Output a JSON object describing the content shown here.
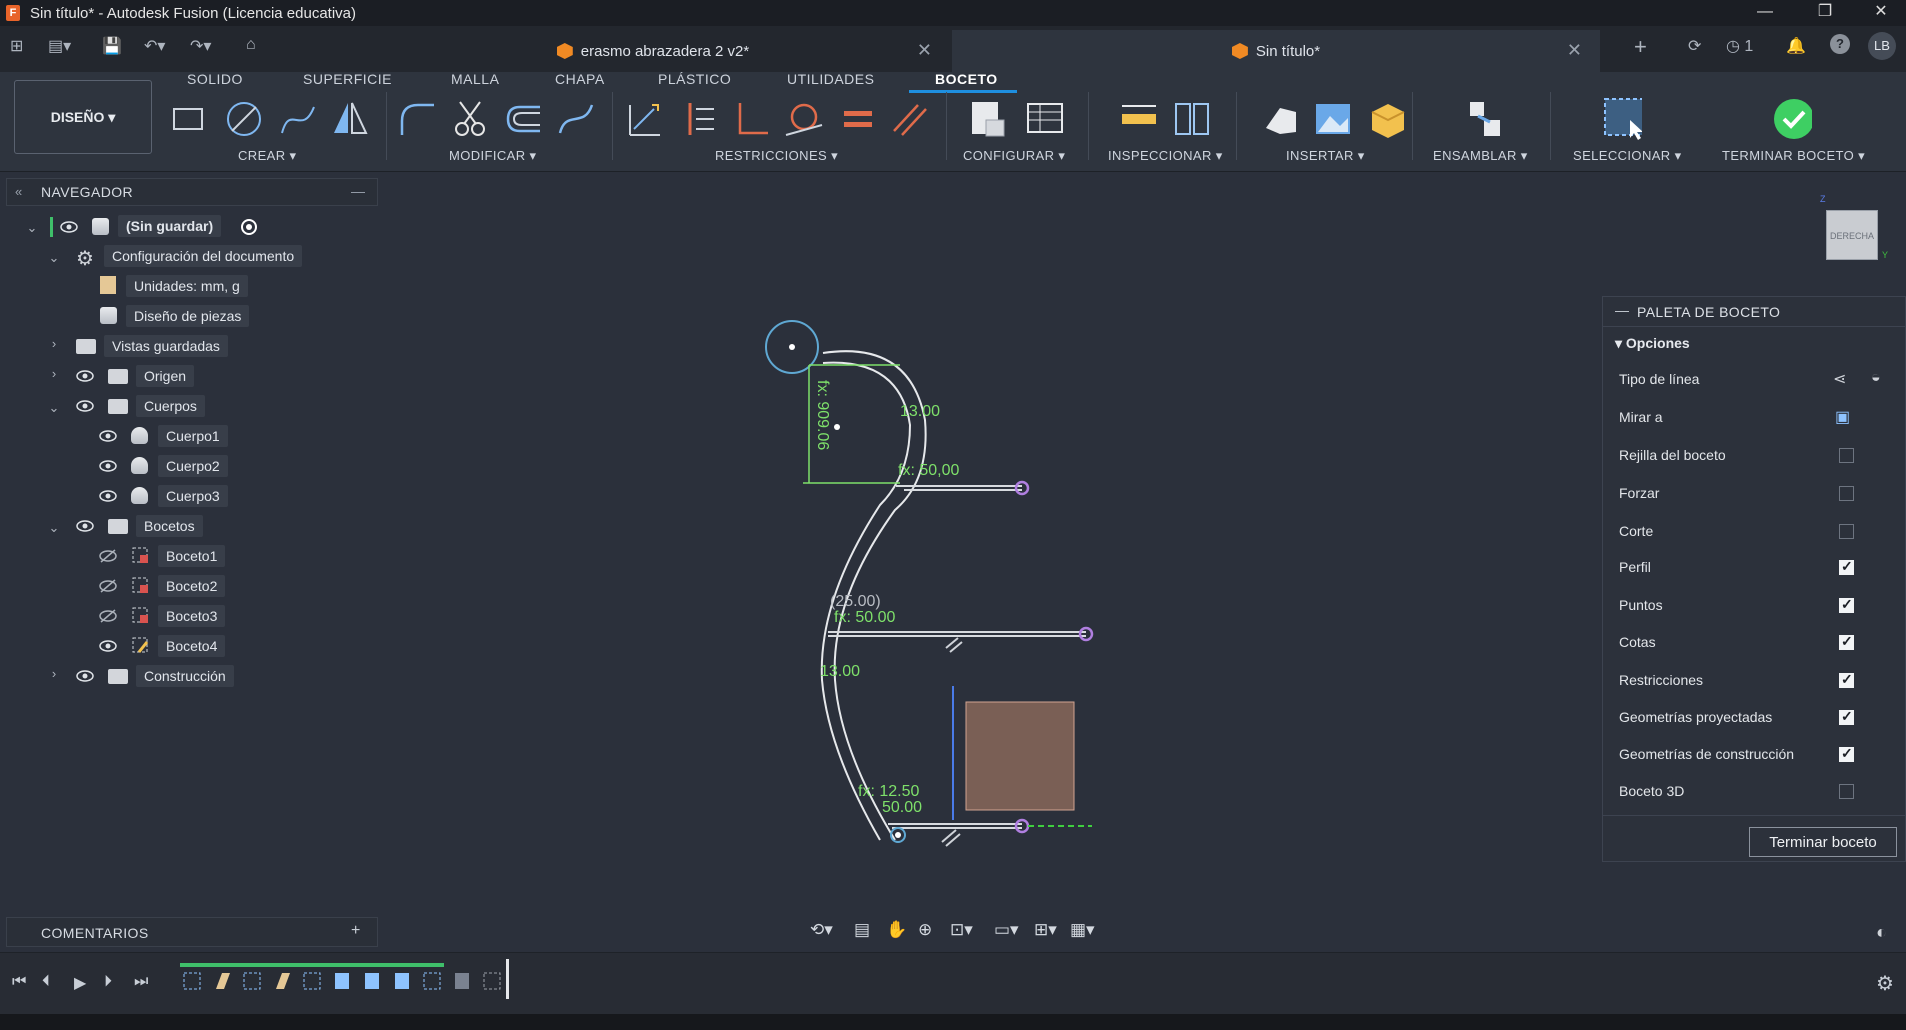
{
  "window": {
    "title": "Sin título* - Autodesk Fusion (Licencia educativa)",
    "minimize": "—",
    "maximize": "❐",
    "close": "✕"
  },
  "doc_tabs": [
    {
      "label": "erasmo abrazadera 2 v2*",
      "close": "✕"
    },
    {
      "label": "Sin título*",
      "close": "✕"
    }
  ],
  "quick_access": {
    "grid": "⊞",
    "file": "▤▾",
    "save": "💾",
    "undo": "↶▾",
    "redo": "↷▾",
    "home": "⌂",
    "new_tab": "+",
    "online": "⟳",
    "jobs": "1",
    "notifications": "🔔",
    "help": "?",
    "user": "LB"
  },
  "workspace_menu": {
    "label": "DISEÑO ▾"
  },
  "workspace_tabs": [
    "SOLIDO",
    "SUPERFICIE",
    "MALLA",
    "CHAPA",
    "PLÁSTICO",
    "UTILIDADES",
    "BOCETO"
  ],
  "toolbar_groups": {
    "crear": "CREAR ▾",
    "modificar": "MODIFICAR ▾",
    "restricciones": "RESTRICCIONES ▾",
    "configurar": "CONFIGURAR ▾",
    "inspeccionar": "INSPECCIONAR ▾",
    "insertar": "INSERTAR ▾",
    "ensamblar": "ENSAMBLAR ▾",
    "seleccionar": "SELECCIONAR ▾",
    "terminar": "TERMINAR BOCETO ▾"
  },
  "navigator": {
    "title": "NAVEGADOR",
    "collapse": "«",
    "minimize": "—",
    "items": [
      {
        "label": "(Sin guardar)"
      },
      {
        "label": "Configuración del documento"
      },
      {
        "label": "Unidades: mm, g"
      },
      {
        "label": "Diseño de piezas"
      },
      {
        "label": "Vistas guardadas"
      },
      {
        "label": "Origen"
      },
      {
        "label": "Cuerpos"
      },
      {
        "label": "Cuerpo1"
      },
      {
        "label": "Cuerpo2"
      },
      {
        "label": "Cuerpo3"
      },
      {
        "label": "Bocetos"
      },
      {
        "label": "Boceto1"
      },
      {
        "label": "Boceto2"
      },
      {
        "label": "Boceto3"
      },
      {
        "label": "Boceto4"
      },
      {
        "label": "Construcción"
      }
    ]
  },
  "comments": {
    "title": "COMENTARIOS",
    "add": "+"
  },
  "viewcube": {
    "face": "DERECHA",
    "z": "Z",
    "y": "Y"
  },
  "sketch": {
    "dims": [
      "fx: 909.06",
      "13.00",
      "fx: 50,00",
      "(25.00)",
      "fx: 50.00",
      "13.00",
      "fx: 12.50",
      "50.00"
    ]
  },
  "palette": {
    "title": "PALETA DE BOCETO",
    "section": "Opciones",
    "rows": [
      {
        "label": "Tipo de línea",
        "type": "icon"
      },
      {
        "label": "Mirar a",
        "type": "icon"
      },
      {
        "label": "Rejilla del boceto",
        "checked": false
      },
      {
        "label": "Forzar",
        "checked": false
      },
      {
        "label": "Corte",
        "checked": false
      },
      {
        "label": "Perfil",
        "checked": true
      },
      {
        "label": "Puntos",
        "checked": true
      },
      {
        "label": "Cotas",
        "checked": true
      },
      {
        "label": "Restricciones",
        "checked": true
      },
      {
        "label": "Geometrías proyectadas",
        "checked": true
      },
      {
        "label": "Geometrías de construcción",
        "checked": true
      },
      {
        "label": "Boceto 3D",
        "checked": false
      }
    ],
    "button": "Terminar boceto"
  },
  "timeline": {
    "first": "⏮",
    "prev": "⏴",
    "play": "▶",
    "next": "⏵",
    "last": "⏭",
    "settings": "⚙"
  }
}
